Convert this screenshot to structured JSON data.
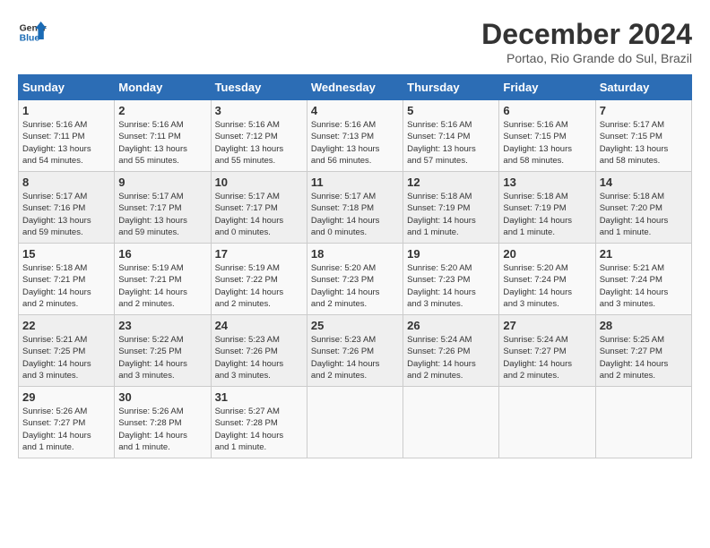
{
  "header": {
    "logo_line1": "General",
    "logo_line2": "Blue",
    "month": "December 2024",
    "location": "Portao, Rio Grande do Sul, Brazil"
  },
  "weekdays": [
    "Sunday",
    "Monday",
    "Tuesday",
    "Wednesday",
    "Thursday",
    "Friday",
    "Saturday"
  ],
  "weeks": [
    [
      {
        "day": "1",
        "info": "Sunrise: 5:16 AM\nSunset: 7:11 PM\nDaylight: 13 hours\nand 54 minutes."
      },
      {
        "day": "2",
        "info": "Sunrise: 5:16 AM\nSunset: 7:11 PM\nDaylight: 13 hours\nand 55 minutes."
      },
      {
        "day": "3",
        "info": "Sunrise: 5:16 AM\nSunset: 7:12 PM\nDaylight: 13 hours\nand 55 minutes."
      },
      {
        "day": "4",
        "info": "Sunrise: 5:16 AM\nSunset: 7:13 PM\nDaylight: 13 hours\nand 56 minutes."
      },
      {
        "day": "5",
        "info": "Sunrise: 5:16 AM\nSunset: 7:14 PM\nDaylight: 13 hours\nand 57 minutes."
      },
      {
        "day": "6",
        "info": "Sunrise: 5:16 AM\nSunset: 7:15 PM\nDaylight: 13 hours\nand 58 minutes."
      },
      {
        "day": "7",
        "info": "Sunrise: 5:17 AM\nSunset: 7:15 PM\nDaylight: 13 hours\nand 58 minutes."
      }
    ],
    [
      {
        "day": "8",
        "info": "Sunrise: 5:17 AM\nSunset: 7:16 PM\nDaylight: 13 hours\nand 59 minutes."
      },
      {
        "day": "9",
        "info": "Sunrise: 5:17 AM\nSunset: 7:17 PM\nDaylight: 13 hours\nand 59 minutes."
      },
      {
        "day": "10",
        "info": "Sunrise: 5:17 AM\nSunset: 7:17 PM\nDaylight: 14 hours\nand 0 minutes."
      },
      {
        "day": "11",
        "info": "Sunrise: 5:17 AM\nSunset: 7:18 PM\nDaylight: 14 hours\nand 0 minutes."
      },
      {
        "day": "12",
        "info": "Sunrise: 5:18 AM\nSunset: 7:19 PM\nDaylight: 14 hours\nand 1 minute."
      },
      {
        "day": "13",
        "info": "Sunrise: 5:18 AM\nSunset: 7:19 PM\nDaylight: 14 hours\nand 1 minute."
      },
      {
        "day": "14",
        "info": "Sunrise: 5:18 AM\nSunset: 7:20 PM\nDaylight: 14 hours\nand 1 minute."
      }
    ],
    [
      {
        "day": "15",
        "info": "Sunrise: 5:18 AM\nSunset: 7:21 PM\nDaylight: 14 hours\nand 2 minutes."
      },
      {
        "day": "16",
        "info": "Sunrise: 5:19 AM\nSunset: 7:21 PM\nDaylight: 14 hours\nand 2 minutes."
      },
      {
        "day": "17",
        "info": "Sunrise: 5:19 AM\nSunset: 7:22 PM\nDaylight: 14 hours\nand 2 minutes."
      },
      {
        "day": "18",
        "info": "Sunrise: 5:20 AM\nSunset: 7:23 PM\nDaylight: 14 hours\nand 2 minutes."
      },
      {
        "day": "19",
        "info": "Sunrise: 5:20 AM\nSunset: 7:23 PM\nDaylight: 14 hours\nand 3 minutes."
      },
      {
        "day": "20",
        "info": "Sunrise: 5:20 AM\nSunset: 7:24 PM\nDaylight: 14 hours\nand 3 minutes."
      },
      {
        "day": "21",
        "info": "Sunrise: 5:21 AM\nSunset: 7:24 PM\nDaylight: 14 hours\nand 3 minutes."
      }
    ],
    [
      {
        "day": "22",
        "info": "Sunrise: 5:21 AM\nSunset: 7:25 PM\nDaylight: 14 hours\nand 3 minutes."
      },
      {
        "day": "23",
        "info": "Sunrise: 5:22 AM\nSunset: 7:25 PM\nDaylight: 14 hours\nand 3 minutes."
      },
      {
        "day": "24",
        "info": "Sunrise: 5:23 AM\nSunset: 7:26 PM\nDaylight: 14 hours\nand 3 minutes."
      },
      {
        "day": "25",
        "info": "Sunrise: 5:23 AM\nSunset: 7:26 PM\nDaylight: 14 hours\nand 2 minutes."
      },
      {
        "day": "26",
        "info": "Sunrise: 5:24 AM\nSunset: 7:26 PM\nDaylight: 14 hours\nand 2 minutes."
      },
      {
        "day": "27",
        "info": "Sunrise: 5:24 AM\nSunset: 7:27 PM\nDaylight: 14 hours\nand 2 minutes."
      },
      {
        "day": "28",
        "info": "Sunrise: 5:25 AM\nSunset: 7:27 PM\nDaylight: 14 hours\nand 2 minutes."
      }
    ],
    [
      {
        "day": "29",
        "info": "Sunrise: 5:26 AM\nSunset: 7:27 PM\nDaylight: 14 hours\nand 1 minute."
      },
      {
        "day": "30",
        "info": "Sunrise: 5:26 AM\nSunset: 7:28 PM\nDaylight: 14 hours\nand 1 minute."
      },
      {
        "day": "31",
        "info": "Sunrise: 5:27 AM\nSunset: 7:28 PM\nDaylight: 14 hours\nand 1 minute."
      },
      {
        "day": "",
        "info": ""
      },
      {
        "day": "",
        "info": ""
      },
      {
        "day": "",
        "info": ""
      },
      {
        "day": "",
        "info": ""
      }
    ]
  ]
}
